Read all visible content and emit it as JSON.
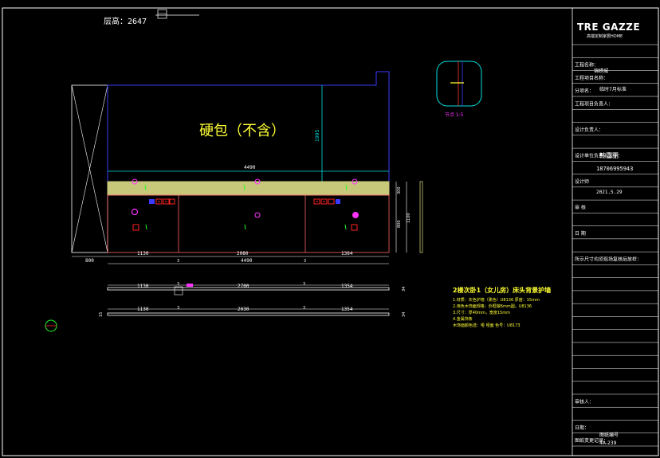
{
  "header": {
    "floor_height": "层高：2647"
  },
  "drawing": {
    "hardpack_label": "硬包（不含）",
    "dim_top_total": "4490",
    "dim_vertical_main": "1995",
    "dim_band_height": "300",
    "dim_right_total": "1100",
    "dim_right_lower": "800",
    "dim_left_offset": "800",
    "dim_bottom_segments": [
      "1130",
      "2080",
      "1364"
    ],
    "dim_bottom_marks": [
      "3",
      "3"
    ],
    "dim_bottom_total": "4490"
  },
  "section_views": {
    "upper_segments": [
      "1130",
      "2700",
      "1354"
    ],
    "upper_marks": [
      "3",
      "3"
    ],
    "upper_end_label": "34",
    "lower_segments": [
      "1130",
      "2030",
      "1354"
    ],
    "lower_marks": [
      "3",
      "3"
    ],
    "lower_end_label": "34",
    "lower_start_label": "15"
  },
  "detail": {
    "label": "节点  1:5"
  },
  "notes": {
    "title": "2楼次卧1（女儿房）床头背景护墙",
    "lines": [
      "1.材质：灰色护墙（柔色）U8136 厚度：15mm",
      "2.用色木饰面规格：外框做6mm圆，U8136",
      "3.尺寸：厚40mm，宽度15mm",
      "4.金属饰条",
      "木饰面颜色选：哑 哑面   色号：U8173"
    ]
  },
  "title_block": {
    "logo": "TRE GAZZE",
    "logo_sub": "高端定制家居HOME",
    "rows": [
      "",
      "工程名称：",
      "工程项目名称：",
      "分项名：",
      "工程项目负责人：",
      "",
      "设计负责人：",
      "",
      "设计单位负责人签字：",
      "",
      "设计师",
      "",
      "审  核",
      "",
      "日  期",
      "",
      "所示尺寸均须现场复核后放样：",
      "",
      "",
      "",
      "",
      "",
      "",
      "",
      "",
      "",
      "",
      "审核人：",
      "",
      "日期：",
      "图纸变更记录："
    ],
    "values": {
      "project": "锦绣城",
      "sub": "临时7月标准",
      "designer_name": "韩嘉丽",
      "phone": "18706995943",
      "date": "2021.5.29",
      "sheet": "图纸编号",
      "code": "4A-239"
    }
  }
}
